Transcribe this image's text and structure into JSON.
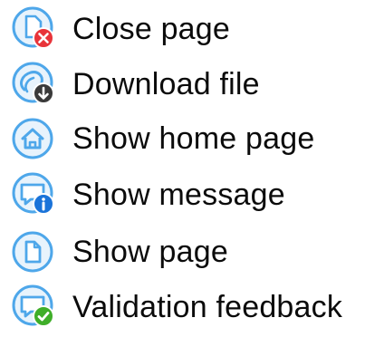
{
  "actions": [
    {
      "label": "Close page",
      "icon": "close-page-icon",
      "badge": "error-badge",
      "badge_color": "#e8343a"
    },
    {
      "label": "Download file",
      "icon": "download-file-icon",
      "badge": "download-badge",
      "badge_color": "#3a3a3a"
    },
    {
      "label": "Show home page",
      "icon": "home-page-icon"
    },
    {
      "label": "Show message",
      "icon": "show-message-icon",
      "badge": "info-badge",
      "badge_color": "#1a73d9"
    },
    {
      "label": "Show page",
      "icon": "show-page-icon"
    },
    {
      "label": "Validation feedback",
      "icon": "validation-feedback-icon",
      "badge": "success-badge",
      "badge_color": "#3fae29"
    }
  ],
  "colors": {
    "icon_circle": "#4ea7ea",
    "icon_fill": "#e8f3fc",
    "text": "#0b0b0b"
  }
}
